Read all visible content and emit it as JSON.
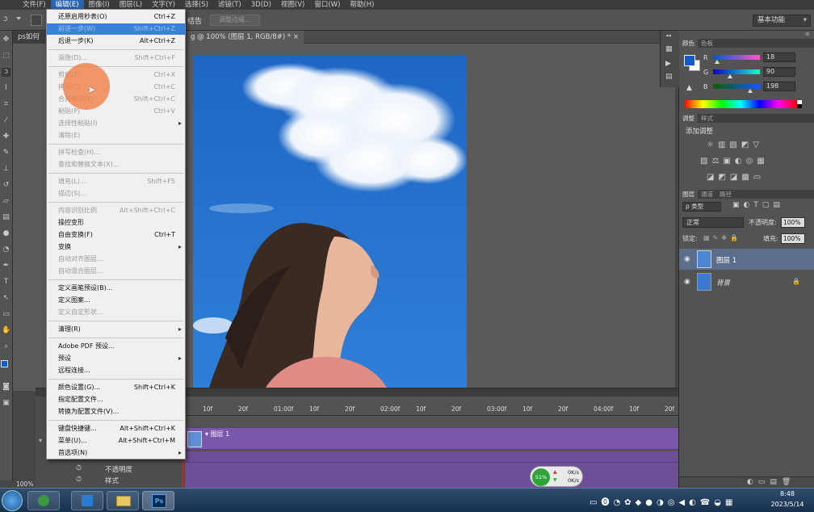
{
  "menubar": {
    "items": [
      "文件(F)",
      "编辑(E)",
      "图像(I)",
      "图层(L)",
      "文字(Y)",
      "选择(S)",
      "滤镜(T)",
      "3D(D)",
      "视图(V)",
      "窗口(W)",
      "帮助(H)"
    ],
    "active_index": 1
  },
  "options_bar": {
    "partial_label": "结告",
    "refine_edge_button": "调整边缘...",
    "workspace_select": "基本功能"
  },
  "document": {
    "tab_left": "ps如何",
    "tab_title": "g @ 100% (图层 1, RGB/8#) *",
    "close_x": "×",
    "zoom": "100%"
  },
  "edit_menu": {
    "items": [
      {
        "label": "还原启用秒表(O)",
        "shortcut": "Ctrl+Z",
        "disabled": false
      },
      {
        "label": "前进一步(W)",
        "shortcut": "Shift+Ctrl+Z",
        "disabled": false,
        "highlighted": true
      },
      {
        "label": "后退一步(K)",
        "shortcut": "Alt+Ctrl+Z",
        "disabled": false
      },
      {
        "sep": true
      },
      {
        "label": "渐隐(D)...",
        "shortcut": "Shift+Ctrl+F",
        "disabled": true
      },
      {
        "sep": true
      },
      {
        "label": "剪切(T)",
        "shortcut": "Ctrl+X",
        "disabled": true
      },
      {
        "label": "拷贝(C)",
        "shortcut": "Ctrl+C",
        "disabled": true
      },
      {
        "label": "合并拷贝(Y)",
        "shortcut": "Shift+Ctrl+C",
        "disabled": true
      },
      {
        "label": "粘贴(P)",
        "shortcut": "Ctrl+V",
        "disabled": true
      },
      {
        "label": "选择性粘贴(I)",
        "shortcut": "",
        "disabled": true,
        "submenu": true
      },
      {
        "label": "清除(E)",
        "shortcut": "",
        "disabled": true
      },
      {
        "sep": true
      },
      {
        "label": "拼写检查(H)...",
        "shortcut": "",
        "disabled": true
      },
      {
        "label": "查找和替换文本(X)...",
        "shortcut": "",
        "disabled": true
      },
      {
        "sep": true
      },
      {
        "label": "填充(L)...",
        "shortcut": "Shift+F5",
        "disabled": true
      },
      {
        "label": "描边(S)...",
        "shortcut": "",
        "disabled": true
      },
      {
        "sep": true
      },
      {
        "label": "内容识别比例",
        "shortcut": "Alt+Shift+Ctrl+C",
        "disabled": true
      },
      {
        "label": "操控变形",
        "shortcut": "",
        "disabled": false
      },
      {
        "label": "自由变换(F)",
        "shortcut": "Ctrl+T",
        "disabled": false
      },
      {
        "label": "变换",
        "shortcut": "",
        "disabled": false,
        "submenu": true
      },
      {
        "label": "自动对齐图层...",
        "shortcut": "",
        "disabled": true
      },
      {
        "label": "自动混合图层...",
        "shortcut": "",
        "disabled": true
      },
      {
        "sep": true
      },
      {
        "label": "定义画笔预设(B)...",
        "shortcut": "",
        "disabled": false
      },
      {
        "label": "定义图案...",
        "shortcut": "",
        "disabled": false
      },
      {
        "label": "定义自定形状...",
        "shortcut": "",
        "disabled": true
      },
      {
        "sep": true
      },
      {
        "label": "清理(R)",
        "shortcut": "",
        "disabled": false,
        "submenu": true
      },
      {
        "sep": true
      },
      {
        "label": "Adobe PDF 预设...",
        "shortcut": "",
        "disabled": false
      },
      {
        "label": "预设",
        "shortcut": "",
        "disabled": false,
        "submenu": true
      },
      {
        "label": "远程连接...",
        "shortcut": "",
        "disabled": false
      },
      {
        "sep": true
      },
      {
        "label": "颜色设置(G)...",
        "shortcut": "Shift+Ctrl+K",
        "disabled": false
      },
      {
        "label": "指定配置文件...",
        "shortcut": "",
        "disabled": false
      },
      {
        "label": "转换为配置文件(V)...",
        "shortcut": "",
        "disabled": false
      },
      {
        "sep": true
      },
      {
        "label": "键盘快捷键...",
        "shortcut": "Alt+Shift+Ctrl+K",
        "disabled": false
      },
      {
        "label": "菜单(U)...",
        "shortcut": "Alt+Shift+Ctrl+M",
        "disabled": false
      },
      {
        "label": "首选项(N)",
        "shortcut": "",
        "disabled": false,
        "submenu": true
      }
    ]
  },
  "color_panel": {
    "tabs": [
      "颜色",
      "色板"
    ],
    "channels": [
      {
        "label": "R",
        "value": "18",
        "slider": 0.07
      },
      {
        "label": "G",
        "value": "90",
        "slider": 0.35
      },
      {
        "label": "B",
        "value": "198",
        "slider": 0.78
      }
    ],
    "foreground": "#125ac6",
    "background": "#ffffff"
  },
  "adjustments_panel": {
    "tabs": [
      "调整",
      "样式"
    ],
    "title": "添加调整"
  },
  "layers_panel": {
    "tabs": [
      "图层",
      "通道",
      "路径"
    ],
    "filter_kind": "ρ 类型",
    "blend_mode": "正常",
    "opacity_label": "不透明度:",
    "opacity_value": "100%",
    "lock_label": "锁定:",
    "fill_label": "填充:",
    "fill_value": "100%",
    "layers": [
      {
        "name": "图层 1",
        "selected": true
      },
      {
        "name": "背景",
        "locked": true
      }
    ]
  },
  "timeline": {
    "ruler": [
      "10f",
      "20f",
      "01:00f",
      "10f",
      "20f",
      "02:00f",
      "10f",
      "20f",
      "03:00f",
      "10f",
      "20f",
      "04:00f",
      "10f",
      "20f",
      "05:0"
    ],
    "track_name": "图层 1",
    "props": [
      "不透明度",
      "样式"
    ]
  },
  "net_widget": {
    "percent": "51%",
    "up": "0K/s",
    "down": "0K/s"
  },
  "taskbar": {
    "time": "8:48",
    "date": "2023/5/14"
  }
}
